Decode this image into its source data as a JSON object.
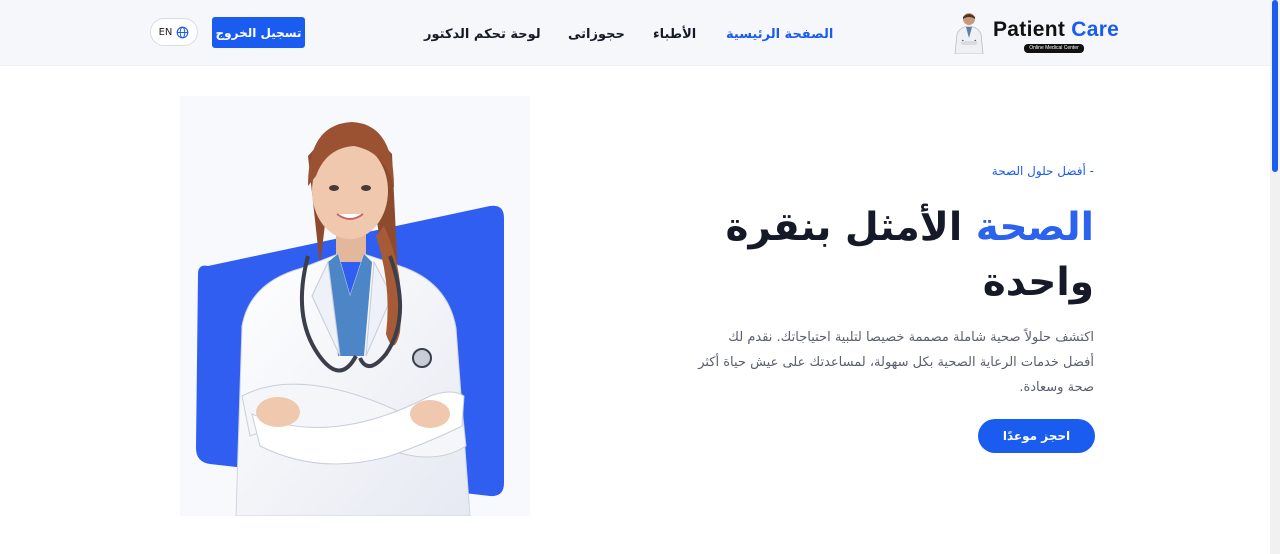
{
  "header": {
    "lang_label": "EN",
    "logout_label": "تسجيل الخروج",
    "nav": {
      "dashboard": "لوحة تحكم الدكتور",
      "bookings": "حجوزاتى",
      "doctors": "الأطباء",
      "home": "الصفحة الرئيسية"
    },
    "logo": {
      "word1": "Patient",
      "word2": "Care",
      "tagline": "Online Medical Center"
    }
  },
  "hero": {
    "eyebrow": "- أفضل حلول الصحة",
    "headline_accent": "الصحة",
    "headline_rest": "الأمثل بنقرة واحدة",
    "description": "اكتشف حلولاً صحية شاملة مصممة خصيصا لتلبية احتياجاتك. نقدم لك أفضل خدمات الرعاية الصحية بكل سهولة، لمساعدتك على عيش حياة أكثر صحة وسعادة.",
    "cta_label": "احجز موعدًا"
  },
  "colors": {
    "primary": "#1a5bf0",
    "accent_text": "#2b63ee",
    "dark_text": "#161a28",
    "muted_text": "#5a5e6e",
    "header_bg": "#f6f7fb"
  },
  "icons": {
    "lang": "globe-icon",
    "hero": "doctor-photo"
  }
}
